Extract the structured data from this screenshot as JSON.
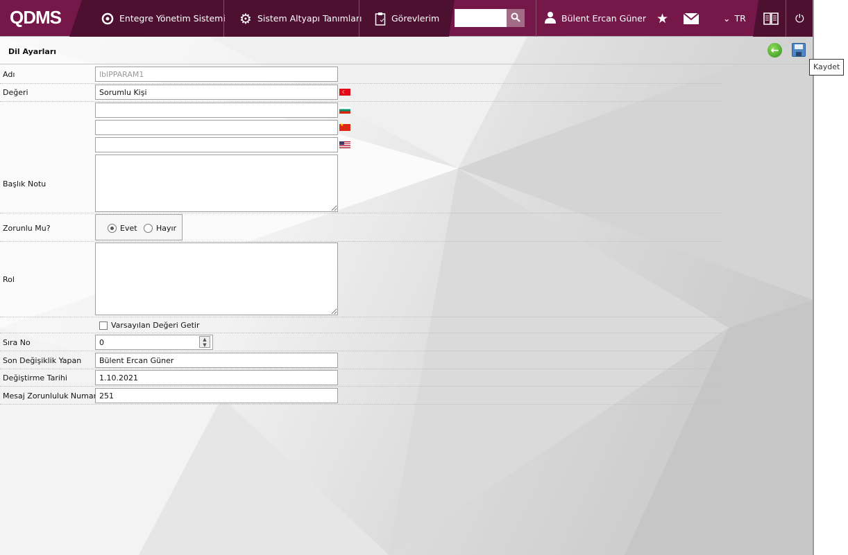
{
  "header": {
    "logo": "QDMS",
    "nav": [
      {
        "label": "Entegre Yönetim Sistemi",
        "icon": "qdms-circle-icon"
      },
      {
        "label": "Sistem Altyapı Tanımları",
        "icon": "gear-icon"
      },
      {
        "label": "Görevlerim",
        "icon": "clipboard-icon"
      }
    ],
    "search_value": "",
    "user": "Bülent Ercan Güner",
    "language": "TR"
  },
  "page": {
    "title": "Dil Ayarları",
    "tooltip": "Kaydet"
  },
  "form": {
    "adi_label": "Adı",
    "adi_value": "lblPPARAM1",
    "degeri_label": "Değeri",
    "degeri_tr": "Sorumlu Kişi",
    "degeri_bg": "",
    "degeri_cn": "",
    "degeri_us": "",
    "baslik_label": "Başlık Notu",
    "baslik_value": "",
    "zorunlu_label": "Zorunlu Mu?",
    "evet": "Evet",
    "hayir": "Hayır",
    "zorunlu_selected": "Evet",
    "rol_label": "Rol",
    "rol_value": "",
    "varsayilan_label": "Varsayılan Değeri Getir",
    "sira_label": "Sıra No",
    "sira_value": "0",
    "son_label": "Son Değişiklik Yapan",
    "son_value": "Bülent Ercan Güner",
    "tarih_label": "Değiştirme Tarihi",
    "tarih_value": "1.10.2021",
    "mesaj_label": "Mesaj Zorunluluk Numarası",
    "mesaj_value": "251"
  }
}
